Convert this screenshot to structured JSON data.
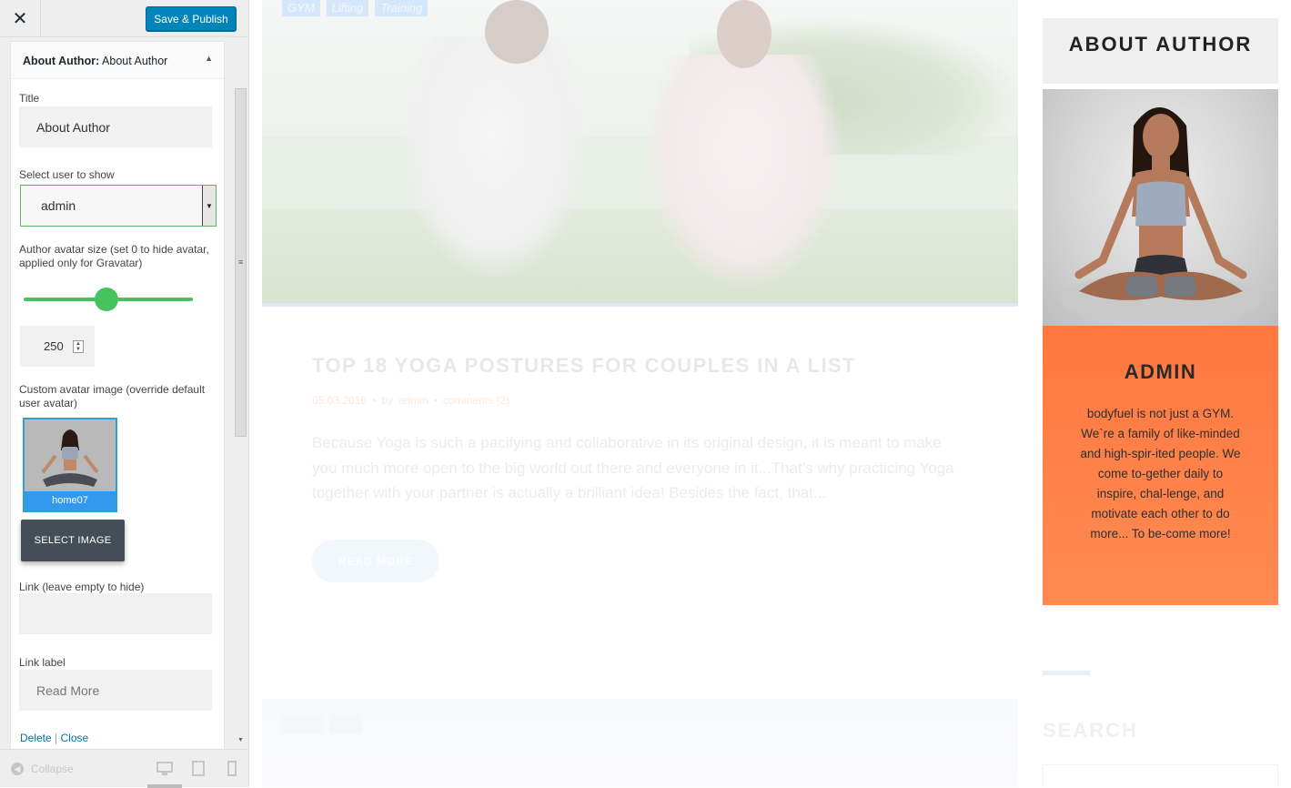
{
  "customizer": {
    "close_glyph": "✕",
    "publish_label": "Save & Publish",
    "widget": {
      "title_prefix": "About Author:",
      "title_name": "About Author",
      "toggle_glyph": "▲",
      "title_label": "Title",
      "title_value": "About Author",
      "user_label": "Select user to show",
      "user_value": "admin",
      "size_label": "Author avatar size (set 0 to hide avatar, applied only for Gravatar)",
      "size_value": "250",
      "custom_avatar_label": "Custom avatar image (override default user avatar)",
      "avatar_caption": "home07",
      "select_image_label": "SELECT IMAGE",
      "link_label": "Link (leave empty to hide)",
      "link_value": "",
      "link_label_label": "Link label",
      "link_label_placeholder": "Read More",
      "delete_label": "Delete",
      "separator": "|",
      "close_label": "Close"
    },
    "footer": {
      "collapse_label": "Collapse"
    },
    "colors": {
      "publish": "#0085ba",
      "slider": "#46c35f",
      "select_image_bg": "#454d56"
    }
  },
  "preview": {
    "tags": [
      "GYM",
      "Lifting",
      "Training"
    ],
    "post": {
      "title": "TOP 18 YOGA POSTURES FOR COUPLES IN A LIST",
      "date": "05.03.2016",
      "by": "by",
      "author": "admin",
      "comments": "comments (2)",
      "excerpt": "Because Yoga is such a pacifying and collaborative in its original design, it is meant to make you much more open to the big world out there and everyone in it...That’s why practicing Yoga together with your partner is actually a brilliant idea! Besides the fact, that...",
      "read_more": "READ MORE"
    },
    "about": {
      "heading": "ABOUT AUTHOR",
      "name": "ADMIN",
      "bio": "bodyfuel is not just a GYM. We`re a family of like-minded and high-spir-ited people. We come to-gether daily to inspire, chal-lenge, and motivate each other to do more... To be-come more!"
    },
    "search_heading": "SEARCH",
    "colors": {
      "about_body": "#ff7840",
      "about_head": "#efefef"
    }
  }
}
